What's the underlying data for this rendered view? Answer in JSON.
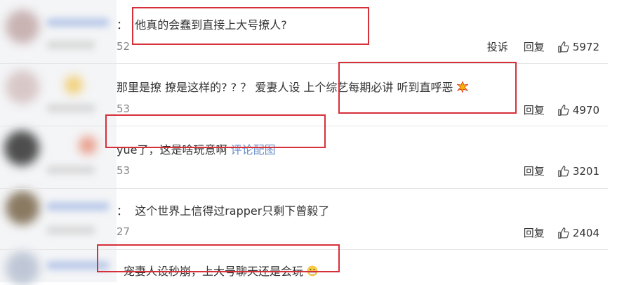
{
  "comments": [
    {
      "prefix": "：",
      "text": "他真的会蠢到直接上大号撩人?",
      "time": "52",
      "report": "投诉",
      "reply": "回复",
      "likes": "5972"
    },
    {
      "text": "那里是撩 撩是这样的? ? ？ 爱妻人设 上个综艺每期必讲 听到直呼恶",
      "emoji": "bang-emoji",
      "time": "53",
      "reply": "回复",
      "likes": "4970"
    },
    {
      "text": "yue了，这是啥玩意啊",
      "link": "评论配图",
      "time": "53",
      "reply": "回复",
      "likes": "3201"
    },
    {
      "prefix": "：",
      "text": "这个世界上信得过rapper只剩下曾毅了",
      "time": "27",
      "reply": "回复",
      "likes": "2404"
    },
    {
      "text": "宠妻人设秒崩，上大号聊天还是会玩",
      "emoji": "grimace-emoji"
    }
  ],
  "colors": {
    "highlight": "#d6303a",
    "link": "#6a8ec9"
  }
}
